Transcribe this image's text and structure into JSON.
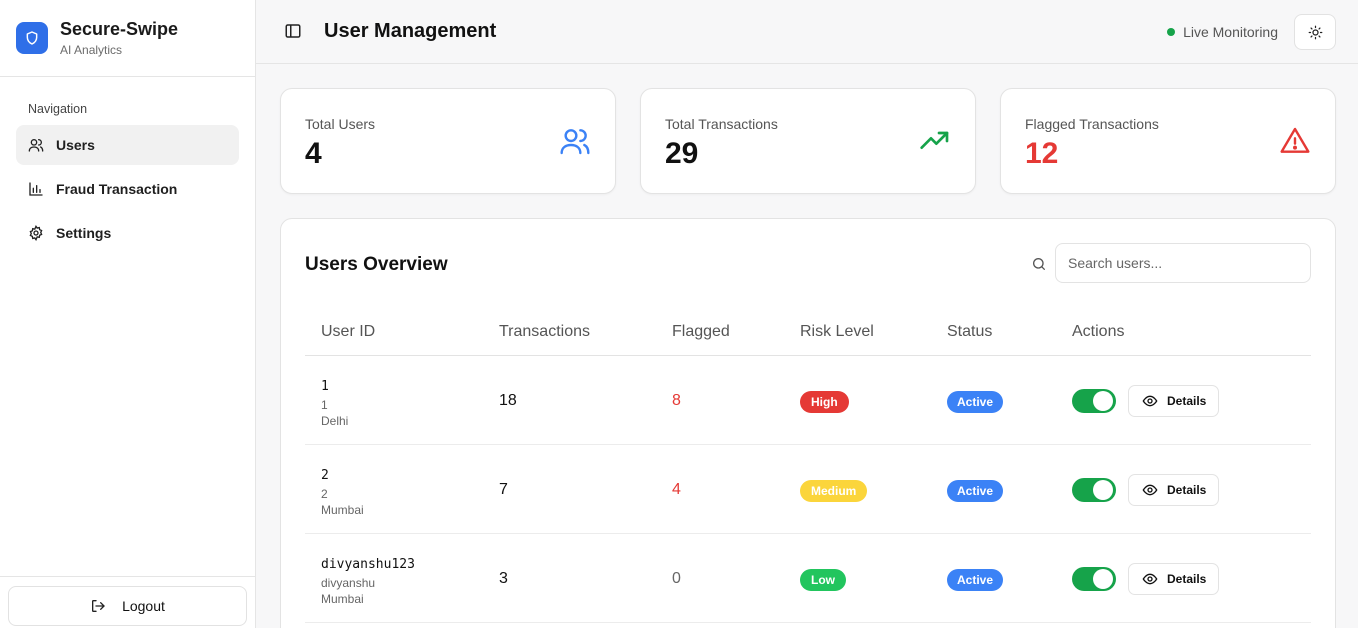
{
  "brand": {
    "title": "Secure-Swipe",
    "subtitle": "AI Analytics",
    "logo_icon": "shield-icon",
    "accent": "#2f6fe8"
  },
  "sidebar": {
    "heading": "Navigation",
    "items": [
      {
        "label": "Users",
        "icon": "users-icon",
        "active": true
      },
      {
        "label": "Fraud Transaction",
        "icon": "bar-chart-icon",
        "active": false
      },
      {
        "label": "Settings",
        "icon": "gear-icon",
        "active": false
      }
    ],
    "logout_label": "Logout"
  },
  "header": {
    "title": "User Management",
    "live_label": "Live Monitoring",
    "live_color": "#16a34a"
  },
  "stats": [
    {
      "label": "Total Users",
      "value": "4",
      "icon": "users-icon",
      "icon_color": "#3b82f6"
    },
    {
      "label": "Total Transactions",
      "value": "29",
      "icon": "trending-up-icon",
      "icon_color": "#16a34a"
    },
    {
      "label": "Flagged Transactions",
      "value": "12",
      "icon": "alert-triangle-icon",
      "icon_color": "#e53935"
    }
  ],
  "users_overview": {
    "title": "Users Overview",
    "search_placeholder": "Search users...",
    "columns": [
      "User ID",
      "Transactions",
      "Flagged",
      "Risk Level",
      "Status",
      "Actions"
    ],
    "rows": [
      {
        "user_id": "1",
        "name": "1",
        "city": "Delhi",
        "transactions": "18",
        "flagged": "8",
        "risk": "High",
        "status": "Active",
        "enabled": true,
        "details_label": "Details"
      },
      {
        "user_id": "2",
        "name": "2",
        "city": "Mumbai",
        "transactions": "7",
        "flagged": "4",
        "risk": "Medium",
        "status": "Active",
        "enabled": true,
        "details_label": "Details"
      },
      {
        "user_id": "divyanshu123",
        "name": "divyanshu",
        "city": "Mumbai",
        "transactions": "3",
        "flagged": "0",
        "risk": "Low",
        "status": "Active",
        "enabled": true,
        "details_label": "Details"
      }
    ]
  },
  "colors": {
    "risk_high": "#e53935",
    "risk_medium": "#fbd53b",
    "risk_low": "#22c55e",
    "status_active": "#3b82f6",
    "flag_red": "#e53935",
    "flag_zero": "#666666"
  }
}
